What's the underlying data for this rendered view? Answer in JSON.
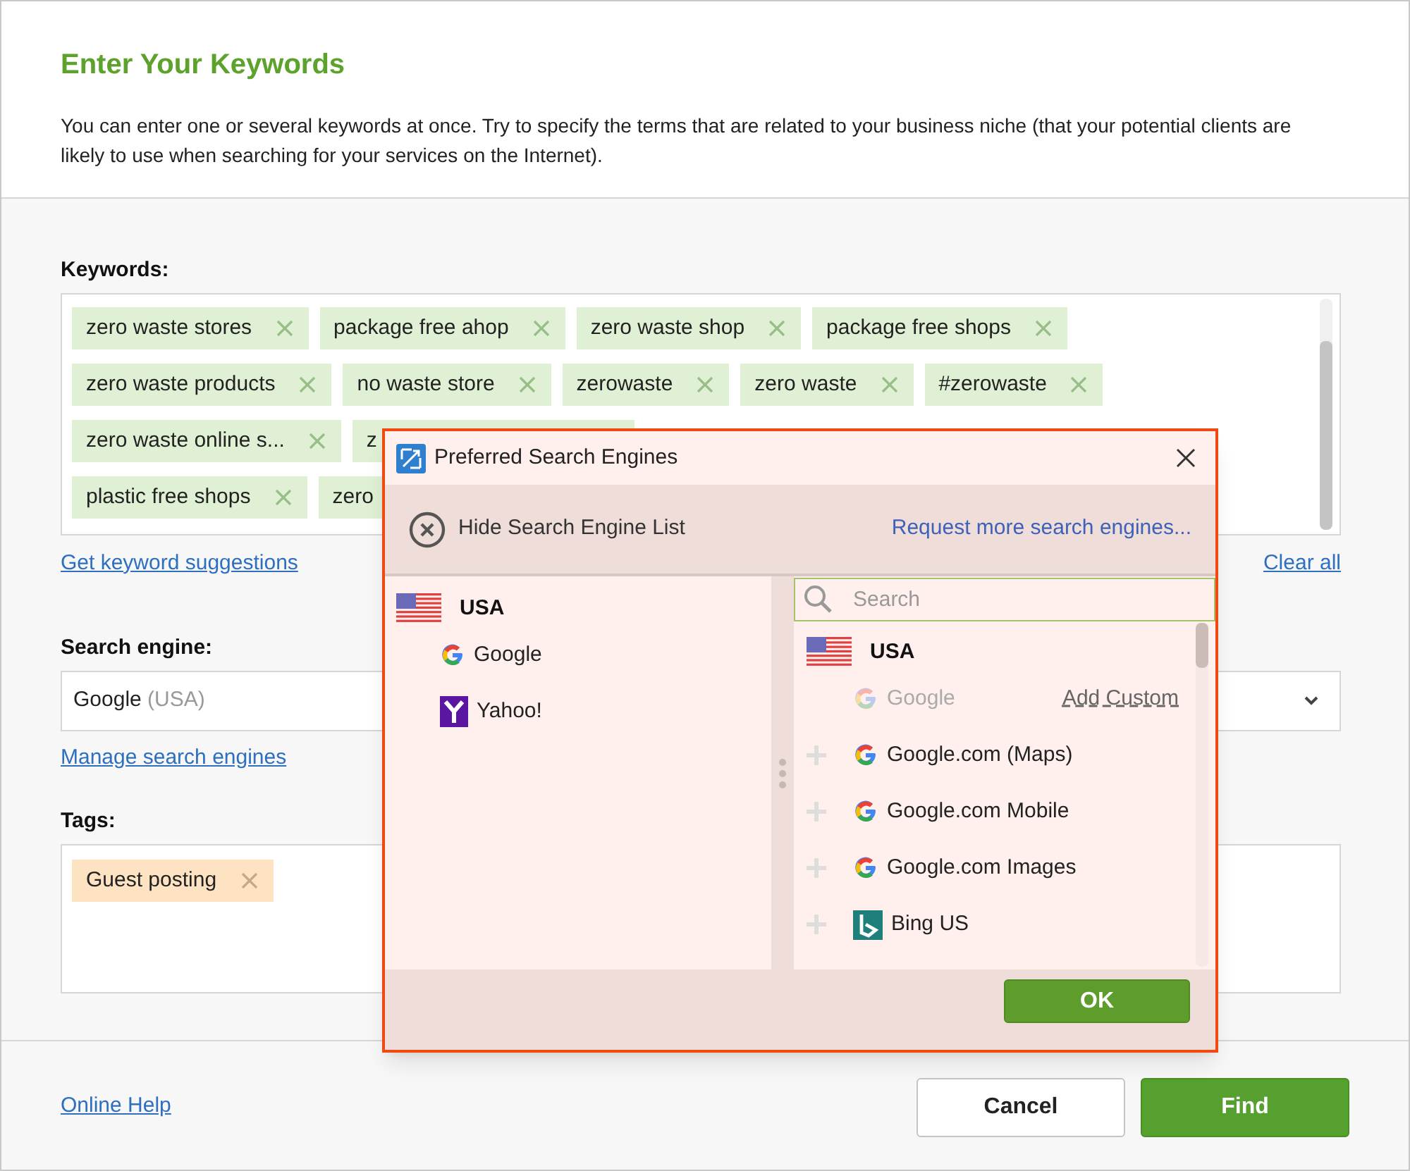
{
  "heading": "Enter Your Keywords",
  "intro": "You can enter one or several keywords at once. Try to specify the terms that are related to your business niche (that your potential clients are likely to use when searching for your services on the Internet).",
  "keywords": {
    "label": "Keywords:",
    "rows": [
      [
        {
          "text": "zero waste stores",
          "kind": "full"
        },
        {
          "text": "package free ahop",
          "kind": "full"
        },
        {
          "text": "zero waste shop",
          "kind": "full"
        },
        {
          "text": "package free shops",
          "kind": "full"
        }
      ],
      [
        {
          "text": "zero waste products",
          "kind": "full"
        },
        {
          "text": "no waste store",
          "kind": "full"
        },
        {
          "text": "zerowaste",
          "kind": "full"
        },
        {
          "text": "zero waste",
          "kind": "full"
        },
        {
          "text": "#zerowaste",
          "kind": "full"
        }
      ],
      [
        {
          "text": "zero waste online s...",
          "kind": "full"
        },
        {
          "text": "z",
          "kind": "partial"
        }
      ],
      [
        {
          "text": "plastic free shops",
          "kind": "full"
        },
        {
          "text": "zero",
          "kind": "partial"
        }
      ]
    ],
    "suggest_link": "Get keyword suggestions",
    "clear_link": "Clear all"
  },
  "search_engine": {
    "label": "Search engine:",
    "value": "Google",
    "region": "(USA)",
    "manage_link": "Manage search engines"
  },
  "tags": {
    "label": "Tags:",
    "chips": [
      {
        "text": "Guest posting"
      }
    ]
  },
  "footer": {
    "help_link": "Online Help",
    "buttons": [
      {
        "label": "Cancel",
        "kind": "secondary"
      },
      {
        "label": "Find",
        "kind": "primary"
      }
    ]
  },
  "dialog": {
    "title": "Preferred Search Engines",
    "hide_label": "Hide Search Engine List",
    "request_link": "Request more search engines...",
    "left_countries": [
      {
        "name": "USA",
        "children": [
          {
            "name": "Google",
            "kind": "google"
          },
          {
            "name": "Yahoo!",
            "kind": "yahoo"
          }
        ]
      }
    ],
    "search": {
      "placeholder": "Search"
    },
    "right_countries": [
      {
        "name": "USA",
        "children": [
          {
            "name": "Google",
            "kind": "google",
            "added": true,
            "action": "Add Custom"
          },
          {
            "name": "Google.com (Maps)",
            "kind": "google",
            "added": false
          },
          {
            "name": "Google.com Mobile",
            "kind": "google",
            "added": false
          },
          {
            "name": "Google.com Images",
            "kind": "google",
            "added": false
          },
          {
            "name": "Bing US",
            "kind": "bing",
            "added": false
          }
        ]
      }
    ],
    "ok": "OK"
  }
}
